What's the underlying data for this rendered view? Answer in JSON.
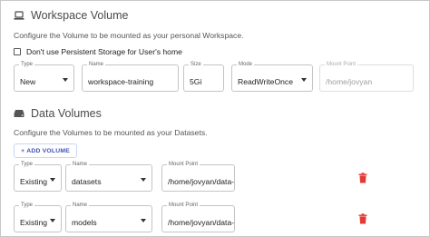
{
  "workspace": {
    "title": "Workspace Volume",
    "description": "Configure the Volume to be mounted as your personal Workspace.",
    "checkbox_label": "Don't use Persistent Storage for User's home",
    "fields": {
      "type_label": "Type",
      "type_value": "New",
      "name_label": "Name",
      "name_value": "workspace-training",
      "size_label": "Size",
      "size_value": "5Gi",
      "mode_label": "Mode",
      "mode_value": "ReadWriteOnce",
      "mount_label": "Mount Point",
      "mount_value": "/home/jovyan"
    }
  },
  "data_volumes": {
    "title": "Data Volumes",
    "description": "Configure the Volumes to be mounted as your Datasets.",
    "add_button_plus": "+",
    "add_button_label": "ADD VOLUME",
    "rows": [
      {
        "type_label": "Type",
        "type_value": "Existing",
        "name_label": "Name",
        "name_value": "datasets",
        "mount_label": "Mount Point",
        "mount_value": "/home/jovyan/data-"
      },
      {
        "type_label": "Type",
        "type_value": "Existing",
        "name_label": "Name",
        "name_value": "models",
        "mount_label": "Mount Point",
        "mount_value": "/home/jovyan/data-"
      }
    ]
  },
  "icons": {
    "workspace": "laptop-icon",
    "data_volumes": "hard-drive-icon",
    "delete": "trash-icon",
    "dropdown": "caret-down-icon"
  },
  "colors": {
    "accent": "#3f51b5",
    "delete": "#e53935"
  }
}
